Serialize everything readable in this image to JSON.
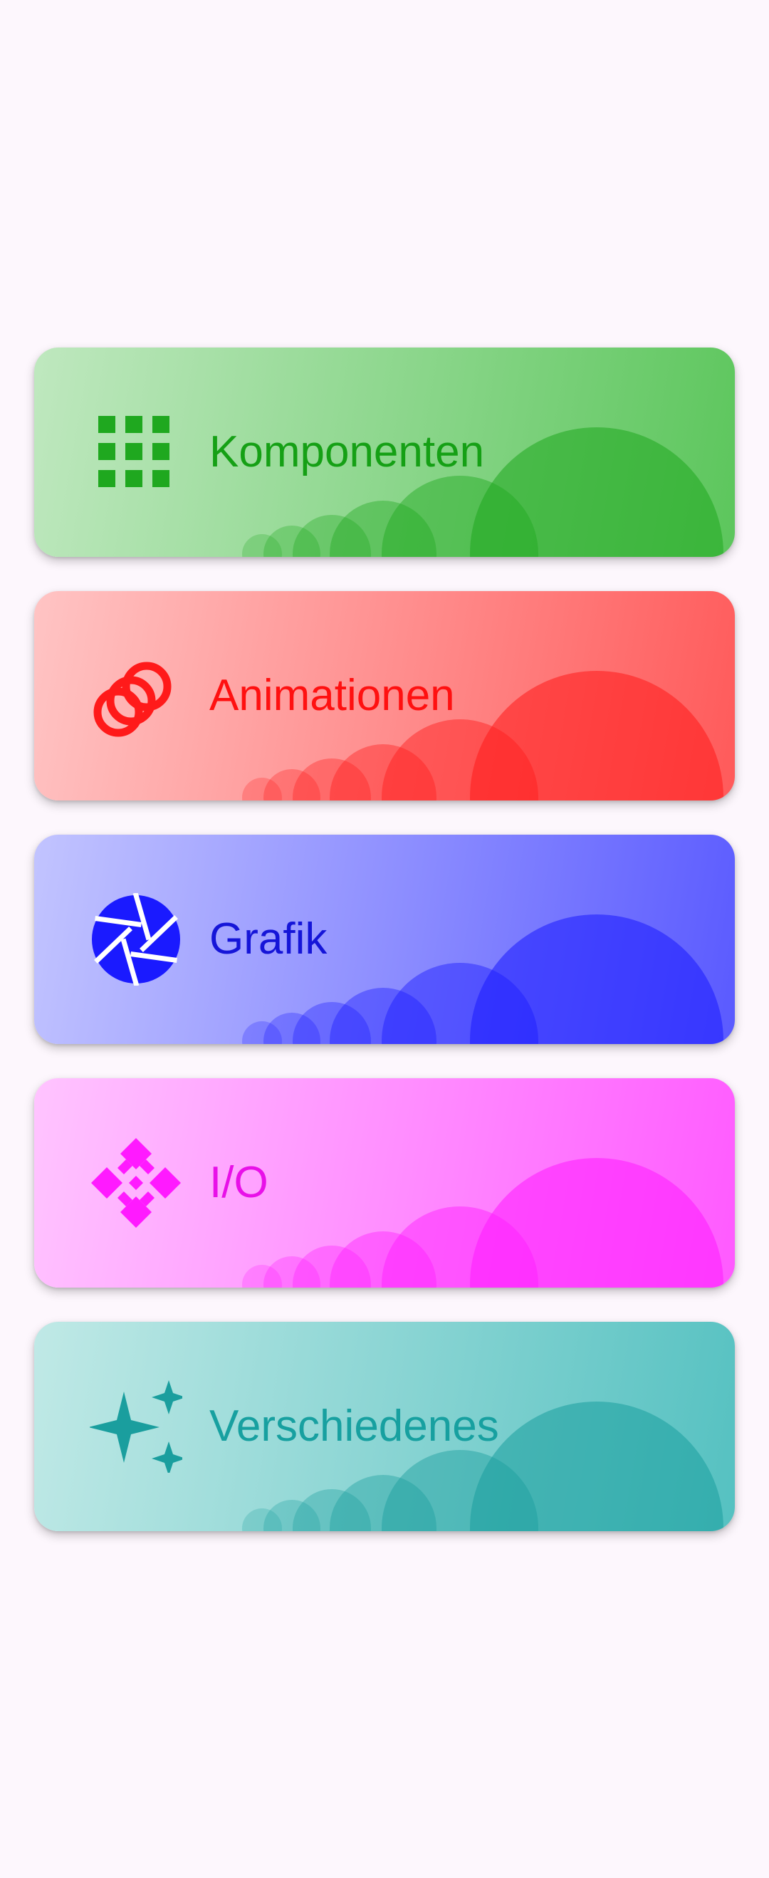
{
  "categories": [
    {
      "id": "komponenten",
      "label": "Komponenten",
      "icon": "apps-grid-icon",
      "text_color": "#15a015",
      "accent": "#1fa81f",
      "gradient_start": "#bfe8bf",
      "gradient_end": "#5cc65c"
    },
    {
      "id": "animationen",
      "label": "Animationen",
      "icon": "animation-circles-icon",
      "text_color": "#ff1010",
      "accent": "#ff1a1a",
      "gradient_start": "#ffc4c4",
      "gradient_end": "#ff5a5a"
    },
    {
      "id": "grafik",
      "label": "Grafik",
      "icon": "camera-shutter-icon",
      "text_color": "#1515d8",
      "accent": "#1a1aff",
      "gradient_start": "#c2c4ff",
      "gradient_end": "#5a5aff"
    },
    {
      "id": "io",
      "label": "I/O",
      "icon": "io-diamond-icon",
      "text_color": "#e810e8",
      "accent": "#ff1aff",
      "gradient_start": "#ffc4ff",
      "gradient_end": "#ff5aff"
    },
    {
      "id": "verschiedenes",
      "label": "Verschiedenes",
      "icon": "sparkle-stars-icon",
      "text_color": "#17a0a0",
      "accent": "#1a9e9e",
      "gradient_start": "#c0e9e6",
      "gradient_end": "#55c1c1"
    }
  ]
}
